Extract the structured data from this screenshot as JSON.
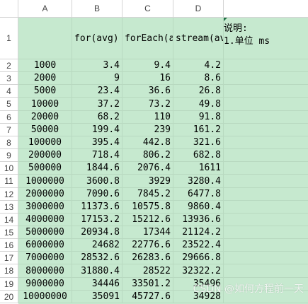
{
  "columns": [
    "A",
    "B",
    "C",
    "D"
  ],
  "header_row": {
    "row_num": "1",
    "b": "for(avg)",
    "c": "forEach(avg)",
    "d": "stream(avg)"
  },
  "note": {
    "line1": "说明:",
    "line2": "1.单位 ms"
  },
  "rows": [
    {
      "n": "2",
      "a": "1000",
      "b": "3.4",
      "c": "9.4",
      "d": "4.2"
    },
    {
      "n": "3",
      "a": "2000",
      "b": "9",
      "c": "16",
      "d": "8.6"
    },
    {
      "n": "4",
      "a": "5000",
      "b": "23.4",
      "c": "36.6",
      "d": "26.8"
    },
    {
      "n": "5",
      "a": "10000",
      "b": "37.2",
      "c": "73.2",
      "d": "49.8"
    },
    {
      "n": "6",
      "a": "20000",
      "b": "68.2",
      "c": "110",
      "d": "91.8"
    },
    {
      "n": "7",
      "a": "50000",
      "b": "199.4",
      "c": "239",
      "d": "161.2"
    },
    {
      "n": "8",
      "a": "100000",
      "b": "395.4",
      "c": "442.8",
      "d": "321.6"
    },
    {
      "n": "9",
      "a": "200000",
      "b": "718.4",
      "c": "806.2",
      "d": "682.8"
    },
    {
      "n": "10",
      "a": "500000",
      "b": "1844.6",
      "c": "2076.4",
      "d": "1611"
    },
    {
      "n": "11",
      "a": "1000000",
      "b": "3600.8",
      "c": "3929",
      "d": "3280.4"
    },
    {
      "n": "12",
      "a": "2000000",
      "b": "7090.6",
      "c": "7845.2",
      "d": "6477.8"
    },
    {
      "n": "13",
      "a": "3000000",
      "b": "11373.6",
      "c": "10575.8",
      "d": "9860.4"
    },
    {
      "n": "14",
      "a": "4000000",
      "b": "17153.2",
      "c": "15212.6",
      "d": "13936.6"
    },
    {
      "n": "15",
      "a": "5000000",
      "b": "20934.8",
      "c": "17344",
      "d": "21124.2"
    },
    {
      "n": "16",
      "a": "6000000",
      "b": "24682",
      "c": "22776.6",
      "d": "23522.4"
    },
    {
      "n": "17",
      "a": "7000000",
      "b": "28532.6",
      "c": "26283.6",
      "d": "29666.8"
    },
    {
      "n": "18",
      "a": "8000000",
      "b": "31880.4",
      "c": "28522",
      "d": "32322.2"
    },
    {
      "n": "19",
      "a": "9000000",
      "b": "34446",
      "c": "33501.2",
      "d": "35496"
    },
    {
      "n": "20",
      "a": "10000000",
      "b": "35091",
      "c": "45727.6",
      "d": "34928"
    }
  ],
  "watermark": "CSDN @如何方程前一天",
  "colors": {
    "fill": "#c6e9cf",
    "marker": "#217346"
  }
}
